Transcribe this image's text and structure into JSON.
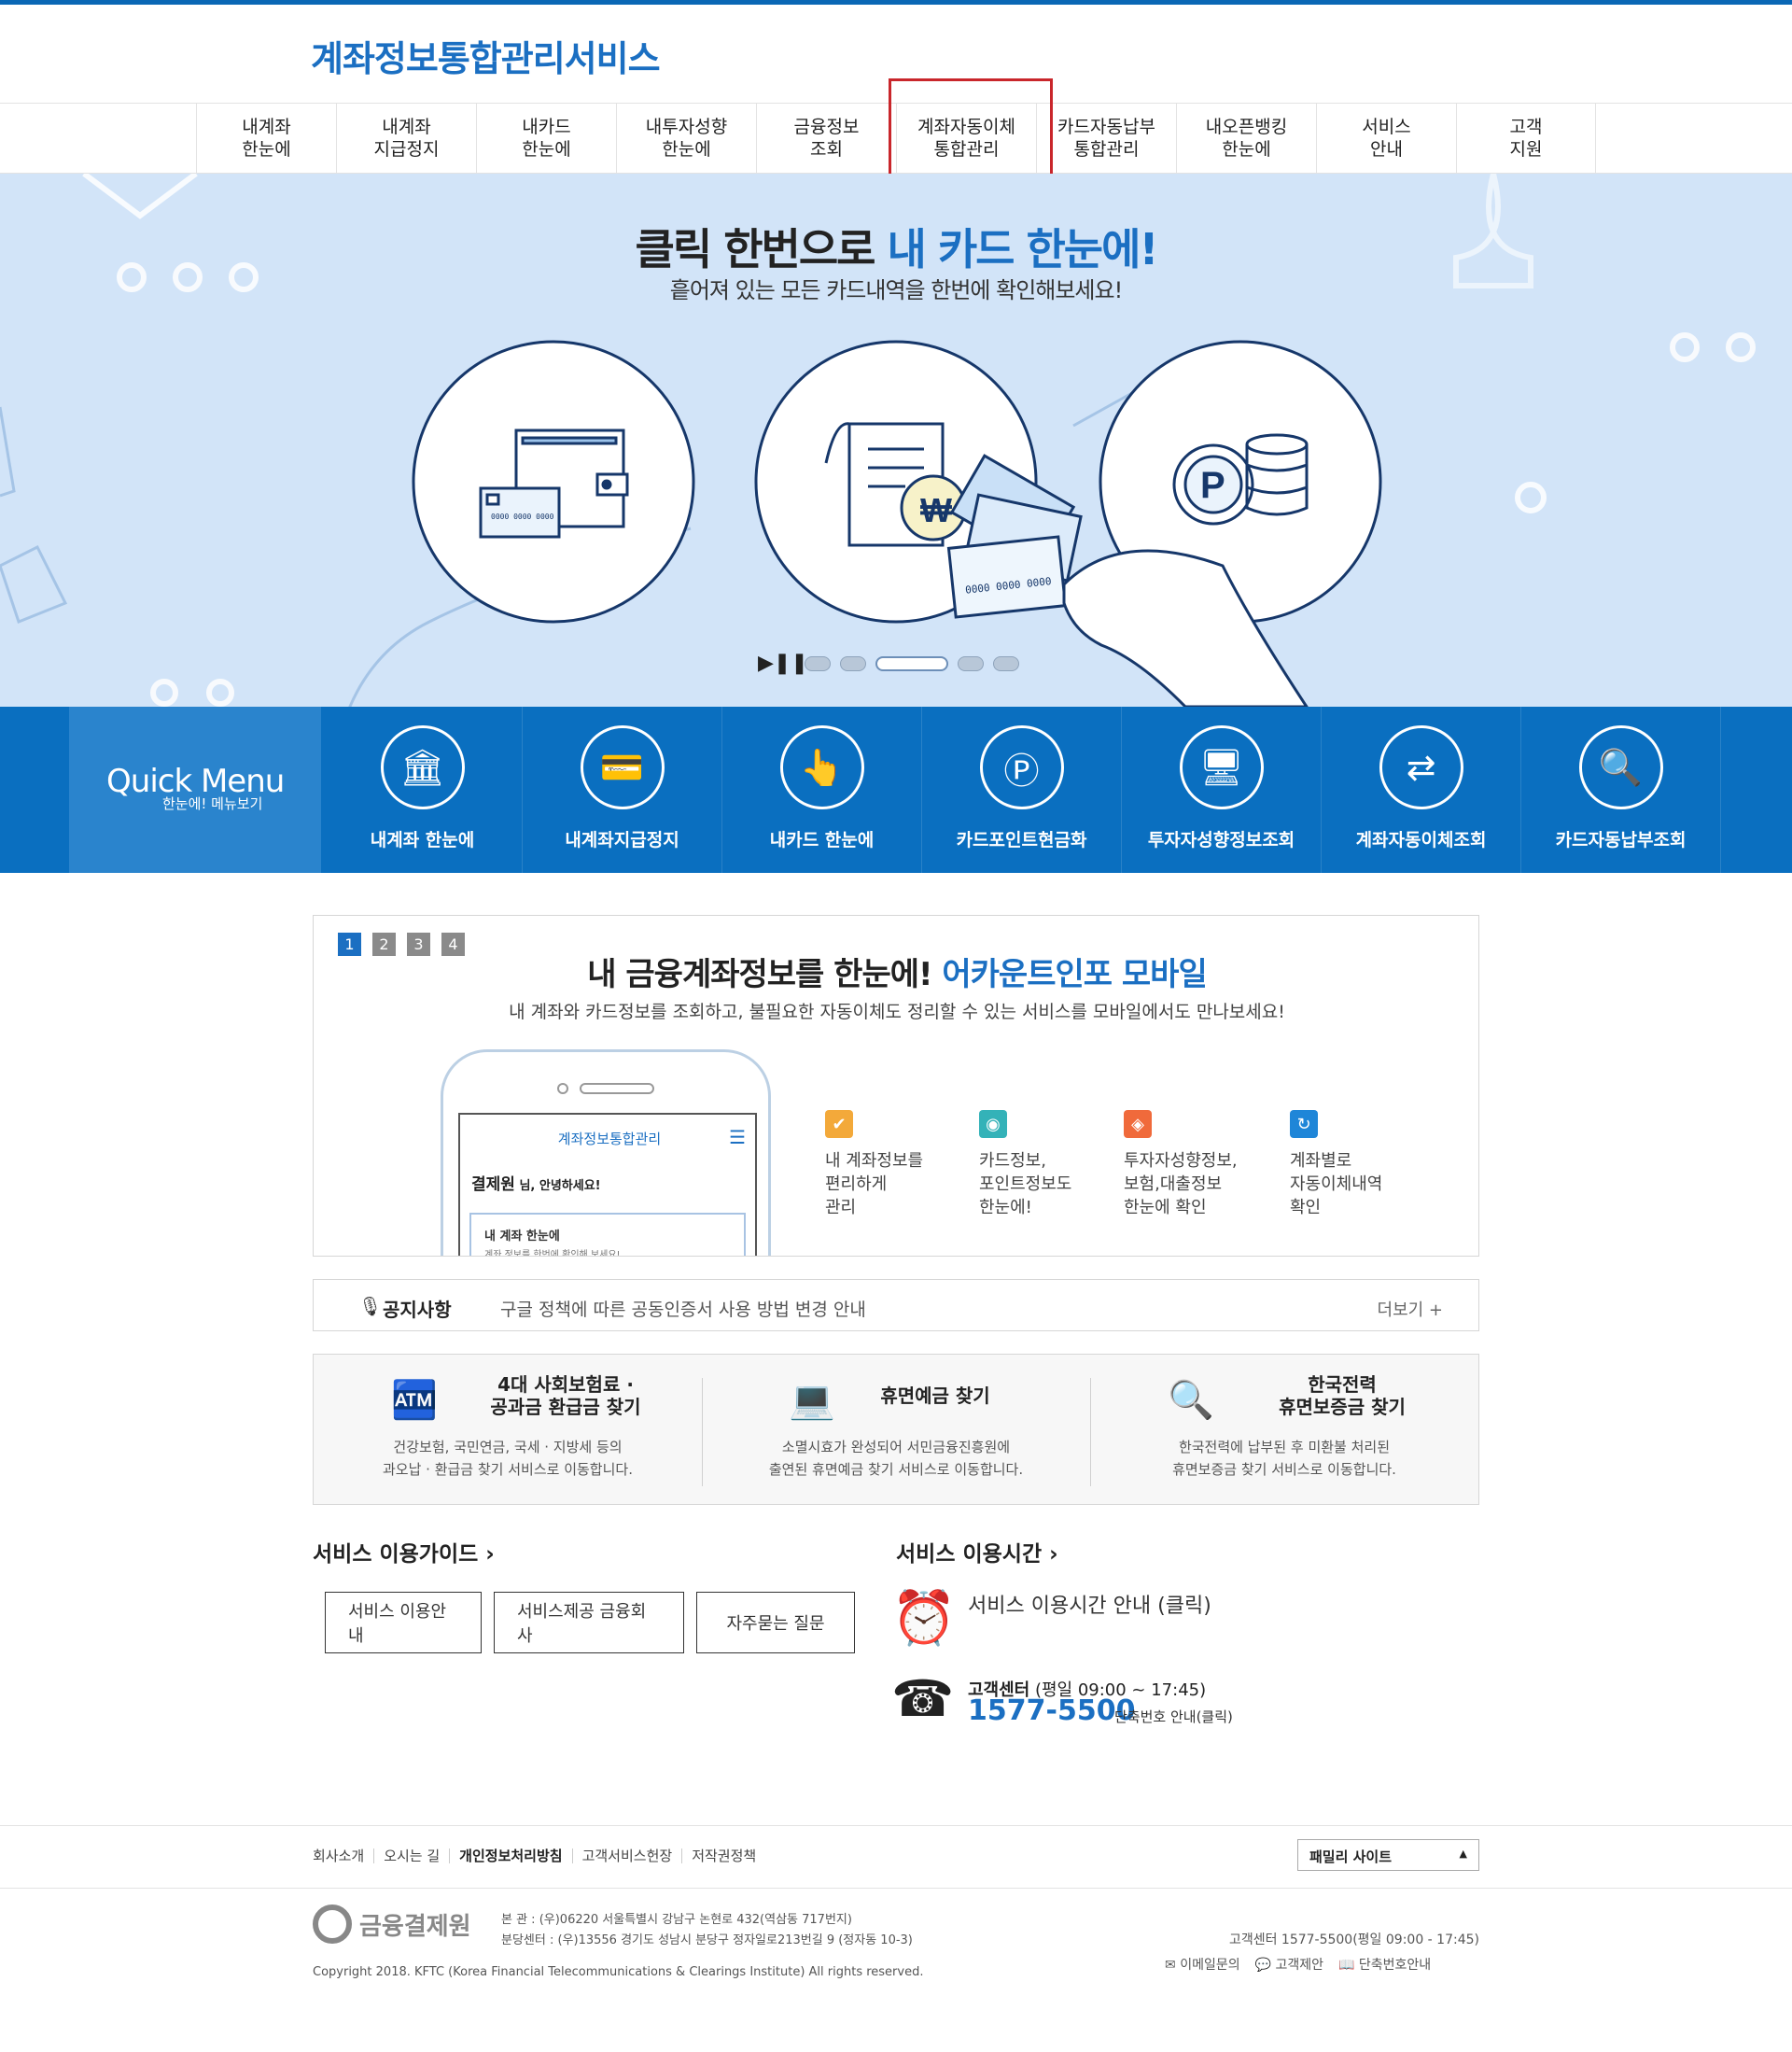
{
  "header": {
    "title": "계좌정보통합관리서비스"
  },
  "nav": [
    {
      "line1": "내계좌",
      "line2": "한눈에"
    },
    {
      "line1": "내계좌",
      "line2": "지급정지"
    },
    {
      "line1": "내카드",
      "line2": "한눈에"
    },
    {
      "line1": "내투자성향",
      "line2": "한눈에"
    },
    {
      "line1": "금융정보",
      "line2": "조회"
    },
    {
      "line1": "계좌자동이체",
      "line2": "통합관리"
    },
    {
      "line1": "카드자동납부",
      "line2": "통합관리"
    },
    {
      "line1": "내오픈뱅킹",
      "line2": "한눈에"
    },
    {
      "line1": "서비스",
      "line2": "안내"
    },
    {
      "line1": "고객",
      "line2": "지원"
    }
  ],
  "banner": {
    "title_black": "클릭 한번으로 ",
    "title_blue": "내 카드 한눈에!",
    "subtitle": "흩어져 있는 모든 카드내역을 한번에 확인해보세요!",
    "slide_count": 5,
    "active_slide": 3,
    "card_text": "0000 0000 0000",
    "point_letter": "P",
    "won_symbol": "₩"
  },
  "quick_menu": {
    "label_main": "uick Menu",
    "label_q": "Q",
    "label_sub": "한눈에! 메뉴보기",
    "items": [
      {
        "label": "내계좌 한눈에",
        "icon": "bank-icon"
      },
      {
        "label": "내계좌지급정지",
        "icon": "card-block-icon"
      },
      {
        "label": "내카드 한눈에",
        "icon": "card-touch-icon"
      },
      {
        "label": "카드포인트현금화",
        "icon": "card-point-icon"
      },
      {
        "label": "투자자성향정보조회",
        "icon": "monitor-search-icon"
      },
      {
        "label": "계좌자동이체조회",
        "icon": "transfer-icon"
      },
      {
        "label": "카드자동납부조회",
        "icon": "payment-search-icon"
      }
    ]
  },
  "mobile_promo": {
    "pages": [
      "1",
      "2",
      "3",
      "4"
    ],
    "active_page": "1",
    "title_black": "내 금융계좌정보를 한눈에! ",
    "title_blue": "어카운트인포 모바일",
    "subtitle": "내 계좌와 카드정보를 조회하고, 불필요한 자동이체도 정리할 수 있는 서비스를 모바일에서도 만나보세요!",
    "phone": {
      "title": "계좌정보통합관리",
      "user": "결제원",
      "greeting": " 님, 안녕하세요!",
      "card_title": "내 계좌 한눈에",
      "card_desc": "계좌 정보를 한번에 확인해 보세요!"
    },
    "features": [
      {
        "text": "내 계좌정보를\n편리하게\n관리",
        "color": "#f3a93a",
        "glyph": "✔"
      },
      {
        "text": "카드정보,\n포인트정보도\n한눈에!",
        "color": "#34b2b8",
        "glyph": "◉"
      },
      {
        "text": "투자자성향정보,\n보험,대출정보\n한눈에 확인",
        "color": "#f06a3b",
        "glyph": "◈"
      },
      {
        "text": "계좌별로\n자동이체내역\n확인",
        "color": "#1f86d8",
        "glyph": "↻"
      }
    ]
  },
  "notice": {
    "label": "공지사항",
    "text": "구글 정책에 따른 공동인증서 사용 방법 변경 안내",
    "more": "더보기 +"
  },
  "refund": [
    {
      "title": "4대 사회보험료 ·\n공과금 환급금 찾기",
      "desc": "건강보험, 국민연금, 국세 · 지방세 등의\n과오납 · 환급금 찾기 서비스로 이동합니다."
    },
    {
      "title": "휴면예금 찾기",
      "desc": "소멸시효가 완성되어 서민금융진흥원에\n출연된 휴면예금 찾기 서비스로 이동합니다."
    },
    {
      "title": "한국전력\n휴면보증금 찾기",
      "desc": "한국전력에 납부된 후 미환불 처리된\n휴면보증금 찾기 서비스로 이동합니다."
    }
  ],
  "guide": {
    "heading": "서비스 이용가이드 ›",
    "buttons": [
      "서비스 이용안내",
      "서비스제공 금융회사",
      "자주묻는 질문"
    ]
  },
  "hours": {
    "heading": "서비스 이용시간 ›",
    "info": "서비스 이용시간 안내 (클릭)",
    "cs_label": "고객센터",
    "cs_hours": " (평일 09:00 ~ 17:45)",
    "cs_number": "1577-5500",
    "cs_ext": "단축번호 안내(클릭)"
  },
  "footer": {
    "links": [
      "회사소개",
      "오시는 길",
      "개인정보처리방침",
      "고객서비스헌장",
      "저작권정책"
    ],
    "family_site": "패밀리 사이트",
    "logo_text": "금융결제원",
    "address": "본       관 : (우)06220 서울특별시 강남구 논현로 432(역삼동 717번지)\n분당센터 : (우)13556 경기도 성남시 분당구 정자일로213번길 9 (정자동 10-3)",
    "copyright": "Copyright 2018. KFTC (Korea Financial Telecommunications & Clearings Institute) All rights reserved.",
    "cs": "고객센터 1577-5500(평일 09:00 - 17:45)",
    "icon_links": [
      "이메일문의",
      "고객제안",
      "단축번호안내"
    ]
  }
}
